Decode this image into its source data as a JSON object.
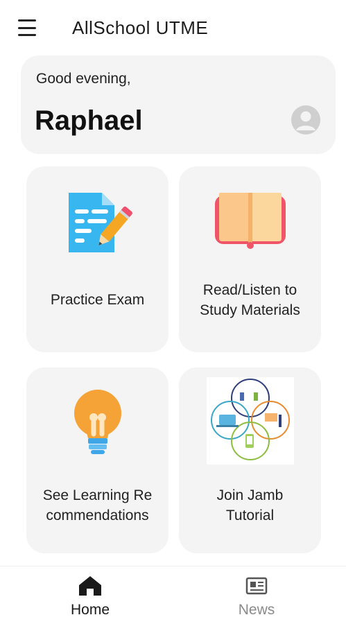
{
  "app": {
    "title": "AllSchool UTME"
  },
  "greeting": {
    "line": "Good evening,",
    "name": "Raphael"
  },
  "tiles": [
    {
      "label_lines": [
        "Practice Exam"
      ],
      "icon": "exam-paper-pencil-icon"
    },
    {
      "label_lines": [
        "Read/Listen to",
        "Study Materials"
      ],
      "icon": "open-book-icon"
    },
    {
      "label_lines": [
        "See Learning Re",
        "commendations"
      ],
      "icon": "light-bulb-icon"
    },
    {
      "label_lines": [
        "Join Jamb",
        "Tutorial"
      ],
      "icon": "tutorial-network-icon"
    }
  ],
  "bottom_nav": [
    {
      "label": "Home",
      "icon": "home-icon",
      "active": true
    },
    {
      "label": "News",
      "icon": "newspaper-icon",
      "active": false
    }
  ],
  "colors": {
    "card_background": "#f4f4f4",
    "nav_active": "#1a1a1a",
    "nav_inactive": "#8a8a8a"
  }
}
